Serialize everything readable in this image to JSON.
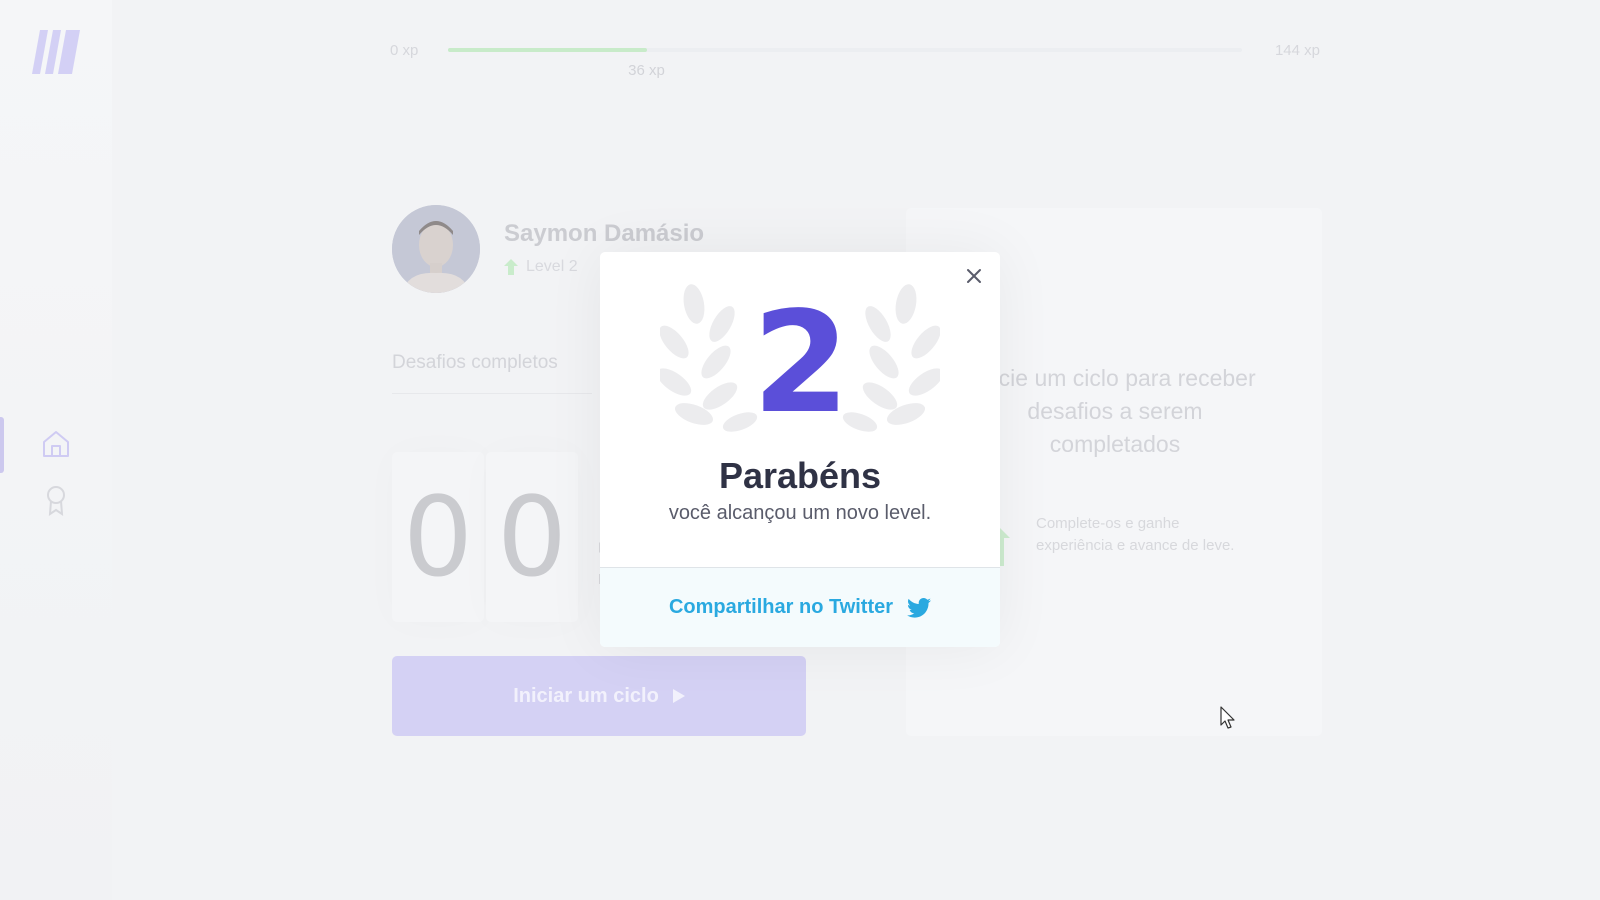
{
  "sidebar": {
    "nav_items": [
      {
        "name": "home",
        "icon": "home-icon",
        "active": true
      },
      {
        "name": "leaderboard",
        "icon": "award-icon",
        "active": false
      }
    ]
  },
  "xp_bar": {
    "min_label": "0 xp",
    "current_label": "36 xp",
    "max_label": "144 xp",
    "progress_percent": 25
  },
  "profile": {
    "name": "Saymon Damásio",
    "level_label": "Level 2"
  },
  "challenges": {
    "completed_label": "Desafios completos"
  },
  "countdown": {
    "digits": [
      "0",
      "0"
    ],
    "separator": ":"
  },
  "start_button": {
    "label": "Iniciar um ciclo"
  },
  "challenge_card": {
    "title": "Inicie um ciclo para receber desafios a serem completados",
    "description": "Complete-os e ganhe experiência e avance de leve."
  },
  "modal": {
    "level": "2",
    "title": "Parabéns",
    "subtitle": "você alcançou um novo level.",
    "share_label": "Compartilhar no Twitter"
  },
  "colors": {
    "accent": "#5b4fd9",
    "twitter": "#2aa9e0",
    "xp_fill": "#c8ebc9",
    "title_text": "#2f3245"
  }
}
